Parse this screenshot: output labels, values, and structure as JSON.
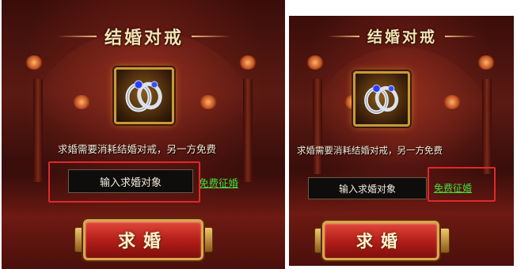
{
  "dialog": {
    "title": "结婚对戒",
    "item_icon": "ring-pair-icon",
    "cost_note": "求婚需要消耗结婚对戒，另一方免费",
    "target_input": {
      "placeholder": "输入求婚对象"
    },
    "free_link": "免费征婚",
    "propose_button": "求婚"
  },
  "colors": {
    "highlight": "#e0282a",
    "link": "#3ee03e",
    "title": "#f7e2b5"
  }
}
